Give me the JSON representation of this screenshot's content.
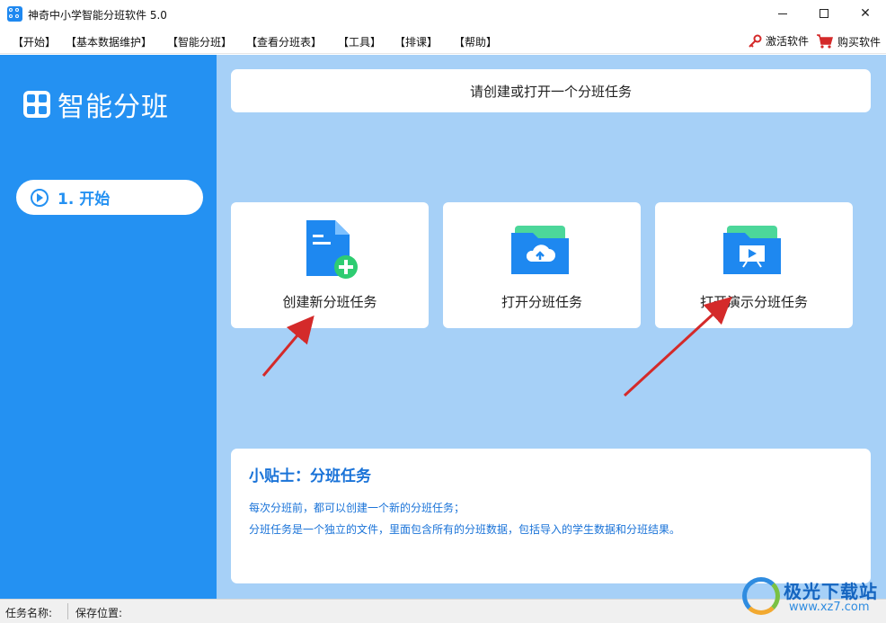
{
  "window": {
    "title": "神奇中小学智能分班软件 5.0",
    "min_glyph": "",
    "max_glyph": "",
    "close_glyph": "✕"
  },
  "menu": {
    "items": [
      "【开始】",
      "【基本数据维护】",
      "【智能分班】",
      "【查看分班表】",
      "【工具】",
      "【排课】",
      "【帮助】"
    ],
    "activate": "激活软件",
    "buy": "购买软件"
  },
  "sidebar": {
    "logo_text": "智能分班",
    "nav_start": "1. 开始"
  },
  "main": {
    "banner": "请创建或打开一个分班任务",
    "cards": [
      {
        "label": "创建新分班任务",
        "icon": "new-document-icon"
      },
      {
        "label": "打开分班任务",
        "icon": "cloud-folder-icon"
      },
      {
        "label": "打开演示分班任务",
        "icon": "presentation-folder-icon"
      }
    ]
  },
  "tips": {
    "title": "小贴士：分班任务",
    "line1": "每次分班前，都可以创建一个新的分班任务；",
    "line2": "分班任务是一个独立的文件，里面包含所有的分班数据，包括导入的学生数据和分班结果。"
  },
  "status": {
    "task_name_label": "任务名称:",
    "save_location_label": "保存位置:"
  },
  "watermark": {
    "text": "极光下载站",
    "url": "www.xz7.com"
  },
  "colors": {
    "sidebar": "#2491f2",
    "main_bg": "#a6d0f7",
    "accent": "#1a73d8",
    "arrow": "#d42a2a"
  }
}
